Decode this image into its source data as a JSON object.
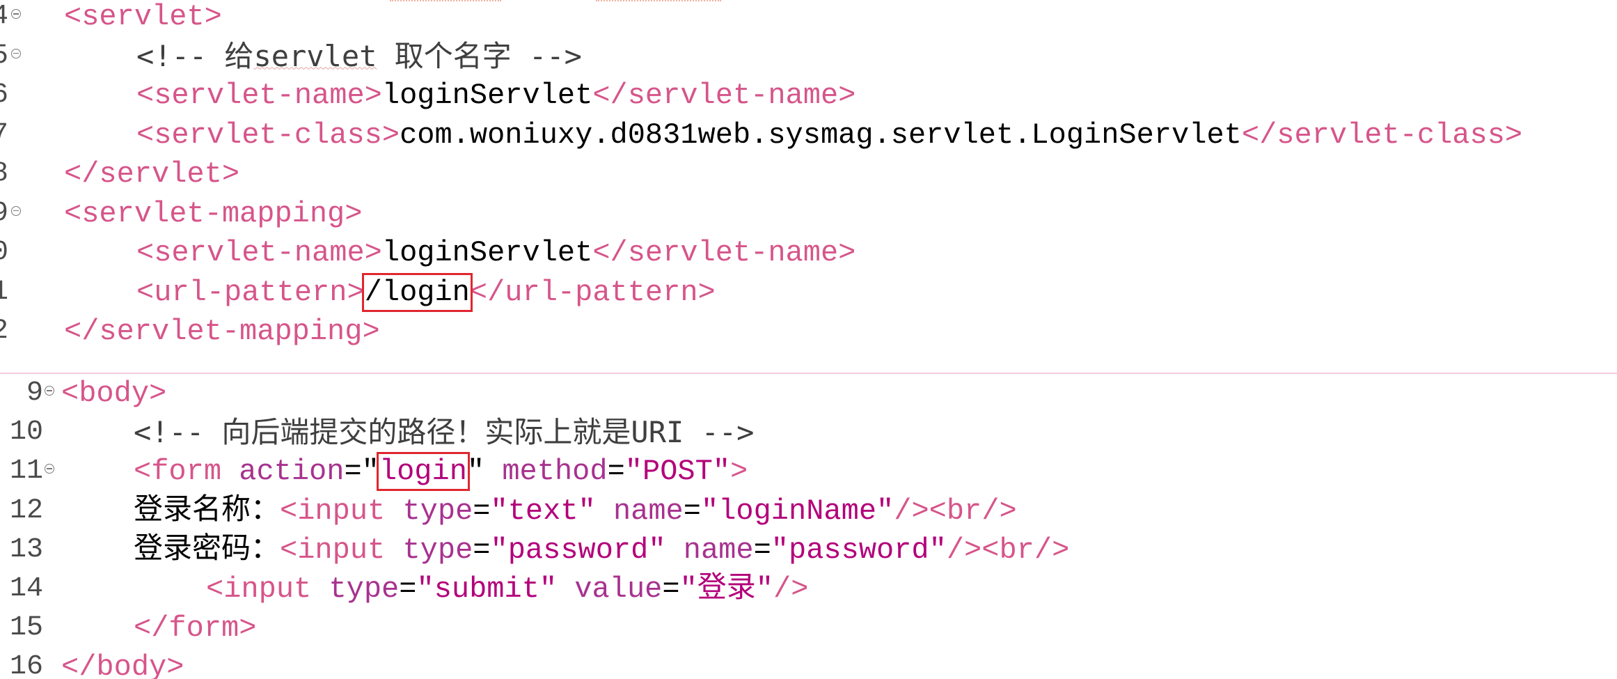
{
  "top_editor": {
    "lines": [
      {
        "num": "4",
        "fold": true,
        "indent": 0,
        "parts": [
          {
            "c": "tag",
            "t": "<servlet>"
          }
        ]
      },
      {
        "num": "5",
        "fold": true,
        "indent": 1,
        "parts": [
          {
            "c": "cmt",
            "t": "<!-- 给"
          },
          {
            "c": "cmt ul",
            "t": "servlet"
          },
          {
            "c": "cmt",
            "t": " 取个名字 -->"
          }
        ]
      },
      {
        "num": "6",
        "fold": false,
        "indent": 1,
        "parts": [
          {
            "c": "tag",
            "t": "<servlet-name>"
          },
          {
            "c": "txt",
            "t": "loginServlet"
          },
          {
            "c": "tag",
            "t": "</servlet-name>"
          }
        ]
      },
      {
        "num": "7",
        "fold": false,
        "indent": 1,
        "parts": [
          {
            "c": "tag",
            "t": "<servlet-class>"
          },
          {
            "c": "txt",
            "t": "com.woniuxy.d0831web.sysmag.servlet.LoginServlet"
          },
          {
            "c": "tag",
            "t": "</servlet-class>"
          }
        ]
      },
      {
        "num": "8",
        "fold": false,
        "indent": 0,
        "parts": [
          {
            "c": "tag",
            "t": "</servlet>"
          }
        ]
      },
      {
        "num": "9",
        "fold": true,
        "indent": 0,
        "parts": [
          {
            "c": "tag",
            "t": "<servlet-mapping>"
          }
        ]
      },
      {
        "num": "0",
        "fold": false,
        "indent": 1,
        "parts": [
          {
            "c": "tag",
            "t": "<servlet-name>"
          },
          {
            "c": "txt",
            "t": "loginServlet"
          },
          {
            "c": "tag",
            "t": "</servlet-name>"
          }
        ]
      },
      {
        "num": "1",
        "fold": false,
        "indent": 1,
        "parts": [
          {
            "c": "tag",
            "t": "<url-pattern>"
          },
          {
            "c": "txt hl",
            "t": "/login"
          },
          {
            "c": "tag",
            "t": "</url-pattern>"
          }
        ]
      },
      {
        "num": "2",
        "fold": false,
        "indent": 0,
        "parts": [
          {
            "c": "tag",
            "t": "</servlet-mapping>"
          }
        ]
      }
    ]
  },
  "bottom_editor": {
    "lines": [
      {
        "num": "9",
        "fold": true,
        "indent": 0,
        "parts": [
          {
            "c": "tag",
            "t": "<body>"
          }
        ]
      },
      {
        "num": "10",
        "fold": false,
        "indent": 1,
        "parts": [
          {
            "c": "cmt",
            "t": "<!-- 向后端提交的路径！实际上就是URI -->"
          }
        ]
      },
      {
        "num": "11",
        "fold": true,
        "indent": 1,
        "parts": [
          {
            "c": "tag",
            "t": "<form "
          },
          {
            "c": "attr",
            "t": "action"
          },
          {
            "c": "punc",
            "t": "=\""
          },
          {
            "c": "val hl",
            "t": "login"
          },
          {
            "c": "punc",
            "t": "\" "
          },
          {
            "c": "attr",
            "t": "method"
          },
          {
            "c": "punc",
            "t": "="
          },
          {
            "c": "val",
            "t": "\"POST\""
          },
          {
            "c": "tag",
            "t": ">"
          }
        ]
      },
      {
        "num": "12",
        "fold": false,
        "indent": 1,
        "parts": [
          {
            "c": "txt",
            "t": "登录名称："
          },
          {
            "c": "tag",
            "t": "<input "
          },
          {
            "c": "attr",
            "t": "type"
          },
          {
            "c": "punc",
            "t": "="
          },
          {
            "c": "val",
            "t": "\"text\""
          },
          {
            "c": "attr",
            "t": " name"
          },
          {
            "c": "punc",
            "t": "="
          },
          {
            "c": "val",
            "t": "\"loginName\""
          },
          {
            "c": "tag",
            "t": "/><br/>"
          }
        ]
      },
      {
        "num": "13",
        "fold": false,
        "indent": 1,
        "parts": [
          {
            "c": "txt",
            "t": "登录密码："
          },
          {
            "c": "tag",
            "t": "<input "
          },
          {
            "c": "attr",
            "t": "type"
          },
          {
            "c": "punc",
            "t": "="
          },
          {
            "c": "val",
            "t": "\"password\""
          },
          {
            "c": "attr",
            "t": " name"
          },
          {
            "c": "punc",
            "t": "="
          },
          {
            "c": "val",
            "t": "\"password\""
          },
          {
            "c": "tag",
            "t": "/><br/>"
          }
        ]
      },
      {
        "num": "14",
        "fold": false,
        "indent": 2,
        "parts": [
          {
            "c": "tag",
            "t": "<input "
          },
          {
            "c": "attr",
            "t": "type"
          },
          {
            "c": "punc",
            "t": "="
          },
          {
            "c": "val",
            "t": "\"submit\""
          },
          {
            "c": "attr",
            "t": " value"
          },
          {
            "c": "punc",
            "t": "="
          },
          {
            "c": "val",
            "t": "\"登录\""
          },
          {
            "c": "tag",
            "t": "/>"
          }
        ]
      },
      {
        "num": "15",
        "fold": false,
        "indent": 1,
        "parts": [
          {
            "c": "tag",
            "t": "</form>"
          }
        ]
      },
      {
        "num": "16",
        "fold": false,
        "indent": 0,
        "parts": [
          {
            "c": "tag",
            "t": "</body>"
          }
        ]
      }
    ]
  },
  "colors": {
    "tag": "#d6558a",
    "attribute": "#a7328f",
    "value": "#b3007a",
    "text": "#000000",
    "comment": "#3f3f3f",
    "highlight_box": "#e0262f",
    "divider": "#f7c9dc"
  }
}
